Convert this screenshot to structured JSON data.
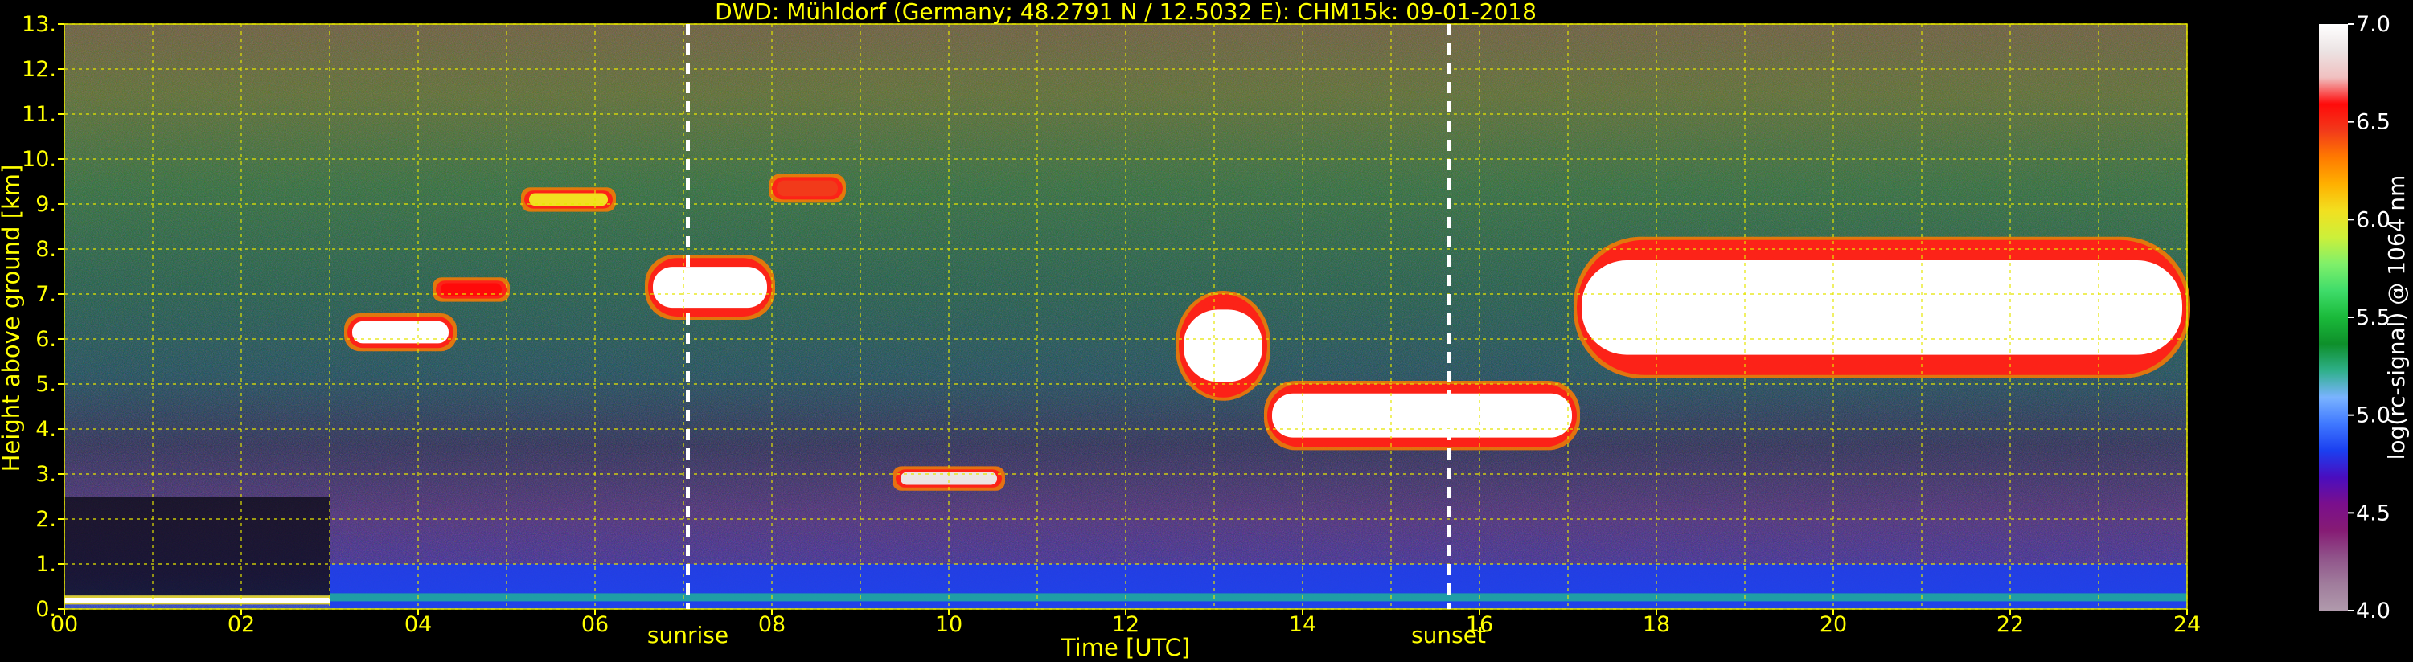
{
  "chart_data": {
    "type": "heatmap",
    "title": "DWD: Mühldorf (Germany; 48.2791 N / 12.5032 E):    CHM15k: 09-01-2018",
    "xlabel": "Time [UTC]",
    "ylabel": "Height above ground [km]",
    "xlim": [
      0,
      24
    ],
    "ylim": [
      0,
      13
    ],
    "x_ticks": [
      "00",
      "02",
      "04",
      "06",
      "08",
      "10",
      "12",
      "14",
      "16",
      "18",
      "20",
      "22",
      "24"
    ],
    "y_ticks": [
      "0.",
      "1.",
      "2.",
      "3.",
      "4.",
      "5.",
      "6.",
      "7.",
      "8.",
      "9.",
      "10.",
      "11.",
      "12.",
      "13."
    ],
    "grid": true,
    "grid_x": [
      0,
      1,
      2,
      3,
      4,
      5,
      6,
      7,
      8,
      9,
      10,
      11,
      12,
      13,
      14,
      15,
      16,
      17,
      18,
      19,
      20,
      21,
      22,
      23,
      24
    ],
    "grid_y": [
      0,
      1,
      2,
      3,
      4,
      5,
      6,
      7,
      8,
      9,
      10,
      11,
      12,
      13
    ],
    "annotations": [
      {
        "x": 7.05,
        "label": "sunrise"
      },
      {
        "x": 15.65,
        "label": "sunset"
      }
    ],
    "colorbar": {
      "label": "log(rc-signal) @ 1064 nm",
      "range": [
        4.0,
        7.0
      ],
      "ticks": [
        "4.0",
        "4.5",
        "5.0",
        "5.5",
        "6.0",
        "6.5",
        "7.0"
      ],
      "colors": [
        "#b09aac",
        "#a07c9c",
        "#90538a",
        "#861b74",
        "#7a0f8c",
        "#4a0dbf",
        "#1b3ff0",
        "#3f78ff",
        "#7ab3ff",
        "#2fb08a",
        "#0e8f2a",
        "#1aba3a",
        "#3fdc6a",
        "#7ff06a",
        "#ccf03a",
        "#f2e020",
        "#ffb000",
        "#ff7a00",
        "#f23a1a",
        "#ff0a0a",
        "#f0c0c0",
        "#ece4e4",
        "#ffffff"
      ]
    },
    "cloud_layers": [
      {
        "x_start": 3.2,
        "x_end": 4.4,
        "base_km": 5.8,
        "top_km": 6.5,
        "level": 7.0
      },
      {
        "x_start": 4.2,
        "x_end": 5.0,
        "base_km": 6.9,
        "top_km": 7.3,
        "level": 6.6
      },
      {
        "x_start": 5.2,
        "x_end": 6.2,
        "base_km": 8.9,
        "top_km": 9.3,
        "level": 6.0
      },
      {
        "x_start": 6.6,
        "x_end": 8.0,
        "base_km": 6.5,
        "top_km": 7.8,
        "level": 7.0
      },
      {
        "x_start": 8.0,
        "x_end": 8.8,
        "base_km": 9.1,
        "top_km": 9.6,
        "level": 6.5
      },
      {
        "x_start": 9.4,
        "x_end": 10.6,
        "base_km": 2.7,
        "top_km": 3.1,
        "level": 6.8
      },
      {
        "x_start": 12.6,
        "x_end": 13.6,
        "base_km": 4.7,
        "top_km": 7.0,
        "level": 7.0
      },
      {
        "x_start": 13.6,
        "x_end": 17.1,
        "base_km": 3.6,
        "top_km": 5.0,
        "level": 7.0
      },
      {
        "x_start": 17.1,
        "x_end": 24.0,
        "base_km": 5.2,
        "top_km": 8.2,
        "level": 7.0
      }
    ],
    "boundary_layer": [
      {
        "x_start": 0.0,
        "x_end": 3.0,
        "base_km": 0.1,
        "top_km": 0.3,
        "level": 6.0
      },
      {
        "x_start": 3.0,
        "x_end": 24.0,
        "base_km": 0.0,
        "top_km": 1.0,
        "level": 4.8
      }
    ]
  }
}
